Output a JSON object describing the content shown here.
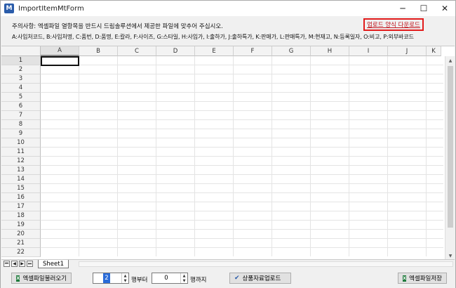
{
  "window": {
    "icon_text": "M",
    "title": "ImportItemMtForm",
    "minimize": "─",
    "maximize": "☐",
    "close": "✕"
  },
  "notice": {
    "text": "주의사항: 엑셀파일 열항목을 반드시 드림솔루션에서 제공한 파일에 맞추어 주십시오.",
    "columns_legend": "A:사입처코드, B:사입처명, C:품번, D:품명, E:칼라, F:사이즈, G:스타일, H:사입가, I:출하가, J:출하특가, K:판매가, L:판매특가, M:현재고, N:등록일자, O:비고, P:외부바코드",
    "download_link": "업로드 양식 다운로드"
  },
  "sheet": {
    "columns": [
      "A",
      "B",
      "C",
      "D",
      "E",
      "F",
      "G",
      "H",
      "I",
      "J",
      "K"
    ],
    "rows": [
      "1",
      "2",
      "3",
      "4",
      "5",
      "6",
      "7",
      "8",
      "9",
      "10",
      "11",
      "12",
      "13",
      "14",
      "15",
      "16",
      "17",
      "18",
      "19",
      "20",
      "21",
      "22"
    ],
    "tab": "Sheet1",
    "nav": [
      "⏮",
      "◀",
      "▶",
      "⏭"
    ]
  },
  "toolbar": {
    "load_button": "엑셀파일불러오기",
    "from_value": "2",
    "from_label": "행부터",
    "to_value": "0",
    "to_label": "행까지",
    "upload_button": "상품자료업로드",
    "save_button": "엑셀파일저장",
    "excel_icon": "X"
  }
}
